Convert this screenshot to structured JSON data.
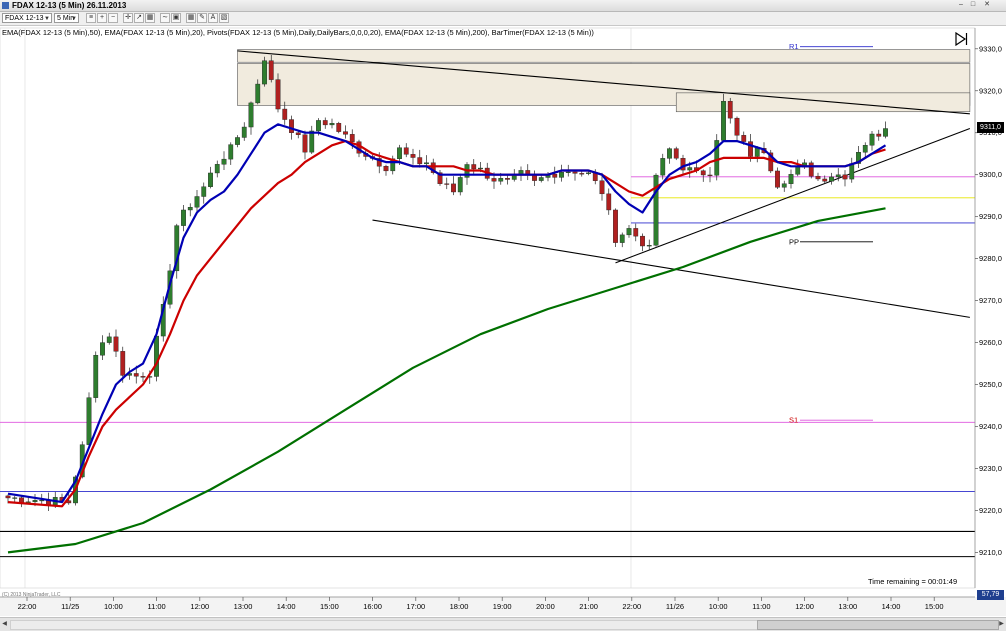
{
  "window": {
    "title": "FDAX 12-13 (5 Min)  26.11.2013"
  },
  "toolbar": {
    "instrument": "FDAX 12-13",
    "interval": "5 Min"
  },
  "indicators_text": "EMA(FDAX 12-13 (5 Min),50),  EMA(FDAX 12-13 (5 Min),20),  Pivots(FDAX 12-13 (5 Min),Daily,DailyBars,0,0,0,20),  EMA(FDAX 12-13 (5 Min),200),  BarTimer(FDAX 12-13 (5 Min))",
  "timer_text": "Time remaining = 00:01:49",
  "footer_info": "(C) 2013 NinjaTrader, LLC",
  "price_tag": "9311,0",
  "indicator_tag": "57,79",
  "colors": {
    "ema20": "#cc0000",
    "ema50": "#0000b4",
    "ema200": "#007000",
    "pivot_r1": "#2b2bcc",
    "pivot_s1": "#dd55dd",
    "pivot_pp": "#000000",
    "zone": "#f1ebde",
    "candle_up": "#2e7d2e",
    "candle_down": "#b02020"
  },
  "chart_data": {
    "type": "candlestick",
    "y_range": [
      9202,
      9334
    ],
    "y_ticks": [
      "9330,0",
      "9320,0",
      "9310,0",
      "9300,0",
      "9290,0",
      "9280,0",
      "9270,0",
      "9260,0",
      "9250,0",
      "9240,0",
      "9230,0",
      "9220,0",
      "9210,0"
    ],
    "x_ticks": [
      "22:00",
      "11/25",
      "10:00",
      "11:00",
      "12:00",
      "13:00",
      "14:00",
      "15:00",
      "16:00",
      "17:00",
      "18:00",
      "19:00",
      "20:00",
      "21:00",
      "22:00",
      "11/26",
      "10:00",
      "11:00",
      "12:00",
      "13:00",
      "14:00",
      "15:00"
    ],
    "price_path": [
      [
        0,
        9223
      ],
      [
        9,
        9222
      ],
      [
        11,
        9235
      ],
      [
        13,
        9258
      ],
      [
        15,
        9262
      ],
      [
        17,
        9253
      ],
      [
        19,
        9252
      ],
      [
        21,
        9253
      ],
      [
        23,
        9268
      ],
      [
        25,
        9288
      ],
      [
        27,
        9293
      ],
      [
        29,
        9297
      ],
      [
        31,
        9303
      ],
      [
        33,
        9306
      ],
      [
        35,
        9312
      ],
      [
        37,
        9322
      ],
      [
        38,
        9328
      ],
      [
        40,
        9316
      ],
      [
        42,
        9311
      ],
      [
        44,
        9306
      ],
      [
        46,
        9313
      ],
      [
        48,
        9312
      ],
      [
        50,
        9309
      ],
      [
        52,
        9306
      ],
      [
        54,
        9304
      ],
      [
        56,
        9302
      ],
      [
        58,
        9306
      ],
      [
        60,
        9303
      ],
      [
        62,
        9303
      ],
      [
        64,
        9298
      ],
      [
        66,
        9296
      ],
      [
        68,
        9303
      ],
      [
        70,
        9301
      ],
      [
        72,
        9299
      ],
      [
        74,
        9298
      ],
      [
        76,
        9300
      ],
      [
        78,
        9298
      ],
      [
        80,
        9300
      ],
      [
        82,
        9301
      ],
      [
        84,
        9301
      ],
      [
        86,
        9300
      ],
      [
        88,
        9296
      ],
      [
        90,
        9285
      ],
      [
        92,
        9287
      ],
      [
        94,
        9284
      ],
      [
        95,
        9282
      ],
      [
        96,
        9300
      ],
      [
        98,
        9306
      ],
      [
        100,
        9302
      ],
      [
        102,
        9300
      ],
      [
        104,
        9301
      ],
      [
        106,
        9317
      ],
      [
        108,
        9309
      ],
      [
        110,
        9305
      ],
      [
        112,
        9306
      ],
      [
        114,
        9298
      ],
      [
        116,
        9300
      ],
      [
        118,
        9302
      ],
      [
        120,
        9299
      ],
      [
        122,
        9300
      ],
      [
        124,
        9300
      ],
      [
        126,
        9306
      ],
      [
        128,
        9309
      ],
      [
        130,
        9311
      ]
    ],
    "series": [
      {
        "name": "EMA(FDAX 12-13 (5 Min),20)",
        "points": [
          [
            0,
            9222
          ],
          [
            8,
            9221
          ],
          [
            10,
            9225
          ],
          [
            12,
            9233
          ],
          [
            14,
            9240
          ],
          [
            16,
            9244
          ],
          [
            18,
            9247
          ],
          [
            20,
            9250
          ],
          [
            22,
            9255
          ],
          [
            24,
            9262
          ],
          [
            26,
            9270
          ],
          [
            28,
            9276
          ],
          [
            30,
            9280
          ],
          [
            32,
            9284
          ],
          [
            34,
            9288
          ],
          [
            36,
            9292
          ],
          [
            38,
            9295
          ],
          [
            40,
            9298
          ],
          [
            42,
            9300
          ],
          [
            44,
            9303
          ],
          [
            46,
            9305
          ],
          [
            48,
            9307
          ],
          [
            50,
            9308
          ],
          [
            52,
            9307
          ],
          [
            54,
            9305
          ],
          [
            56,
            9304
          ],
          [
            58,
            9303
          ],
          [
            60,
            9302
          ],
          [
            62,
            9302
          ],
          [
            64,
            9302
          ],
          [
            66,
            9302
          ],
          [
            68,
            9301
          ],
          [
            70,
            9301
          ],
          [
            72,
            9300
          ],
          [
            74,
            9300
          ],
          [
            76,
            9300
          ],
          [
            78,
            9300
          ],
          [
            80,
            9300
          ],
          [
            82,
            9301
          ],
          [
            84,
            9301
          ],
          [
            86,
            9301
          ],
          [
            88,
            9300
          ],
          [
            90,
            9298
          ],
          [
            92,
            9296
          ],
          [
            94,
            9295
          ],
          [
            96,
            9297
          ],
          [
            98,
            9299
          ],
          [
            100,
            9300
          ],
          [
            102,
            9301
          ],
          [
            104,
            9303
          ],
          [
            106,
            9304
          ],
          [
            108,
            9304
          ],
          [
            110,
            9304
          ],
          [
            112,
            9304
          ],
          [
            114,
            9303
          ],
          [
            116,
            9303
          ],
          [
            118,
            9302
          ],
          [
            120,
            9302
          ],
          [
            122,
            9302
          ],
          [
            124,
            9302
          ],
          [
            126,
            9303
          ],
          [
            128,
            9305
          ],
          [
            130,
            9306
          ]
        ]
      },
      {
        "name": "EMA(FDAX 12-13 (5 Min),50)",
        "points": [
          [
            0,
            9224
          ],
          [
            8,
            9222
          ],
          [
            10,
            9227
          ],
          [
            12,
            9235
          ],
          [
            14,
            9243
          ],
          [
            16,
            9250
          ],
          [
            18,
            9253
          ],
          [
            20,
            9255
          ],
          [
            22,
            9262
          ],
          [
            24,
            9274
          ],
          [
            26,
            9285
          ],
          [
            28,
            9291
          ],
          [
            30,
            9294
          ],
          [
            32,
            9296
          ],
          [
            34,
            9300
          ],
          [
            36,
            9305
          ],
          [
            38,
            9310
          ],
          [
            40,
            9312
          ],
          [
            42,
            9311
          ],
          [
            44,
            9310
          ],
          [
            46,
            9310
          ],
          [
            48,
            9309
          ],
          [
            50,
            9308
          ],
          [
            52,
            9306
          ],
          [
            54,
            9304
          ],
          [
            56,
            9303
          ],
          [
            58,
            9303
          ],
          [
            60,
            9302
          ],
          [
            62,
            9302
          ],
          [
            64,
            9300
          ],
          [
            66,
            9300
          ],
          [
            68,
            9300
          ],
          [
            70,
            9300
          ],
          [
            72,
            9300
          ],
          [
            74,
            9300
          ],
          [
            76,
            9300
          ],
          [
            78,
            9300
          ],
          [
            80,
            9300
          ],
          [
            82,
            9301
          ],
          [
            84,
            9301
          ],
          [
            86,
            9301
          ],
          [
            88,
            9300
          ],
          [
            90,
            9296
          ],
          [
            92,
            9293
          ],
          [
            94,
            9291
          ],
          [
            96,
            9296
          ],
          [
            98,
            9300
          ],
          [
            100,
            9302
          ],
          [
            102,
            9303
          ],
          [
            104,
            9305
          ],
          [
            106,
            9308
          ],
          [
            108,
            9308
          ],
          [
            110,
            9307
          ],
          [
            112,
            9306
          ],
          [
            114,
            9303
          ],
          [
            116,
            9302
          ],
          [
            118,
            9302
          ],
          [
            120,
            9302
          ],
          [
            122,
            9302
          ],
          [
            124,
            9302
          ],
          [
            126,
            9303
          ],
          [
            128,
            9305
          ],
          [
            130,
            9307
          ]
        ]
      },
      {
        "name": "EMA(FDAX 12-13 (5 Min),200)",
        "points": [
          [
            0,
            9210
          ],
          [
            10,
            9212
          ],
          [
            20,
            9217
          ],
          [
            30,
            9225
          ],
          [
            40,
            9234
          ],
          [
            50,
            9244
          ],
          [
            60,
            9254
          ],
          [
            70,
            9262
          ],
          [
            80,
            9268
          ],
          [
            90,
            9273
          ],
          [
            100,
            9278
          ],
          [
            110,
            9284
          ],
          [
            120,
            9289
          ],
          [
            130,
            9292
          ]
        ]
      }
    ],
    "pivots": [
      {
        "name": "R1",
        "value": 9330.5
      },
      {
        "name": "PP",
        "value": 9284
      },
      {
        "name": "S1",
        "value": 9241.5
      }
    ],
    "horizontal_levels": [
      {
        "value": 9299.5,
        "color": "#dd55dd"
      },
      {
        "value": 9294.5,
        "color": "#e6e600"
      },
      {
        "value": 9288.5,
        "color": "#2b2bcc"
      },
      {
        "value": 9241,
        "color": "#dd55dd"
      },
      {
        "value": 9224.5,
        "color": "#2b2bcc"
      },
      {
        "value": 9215,
        "color": "#000000"
      },
      {
        "value": 9209,
        "color": "#000000"
      }
    ]
  }
}
